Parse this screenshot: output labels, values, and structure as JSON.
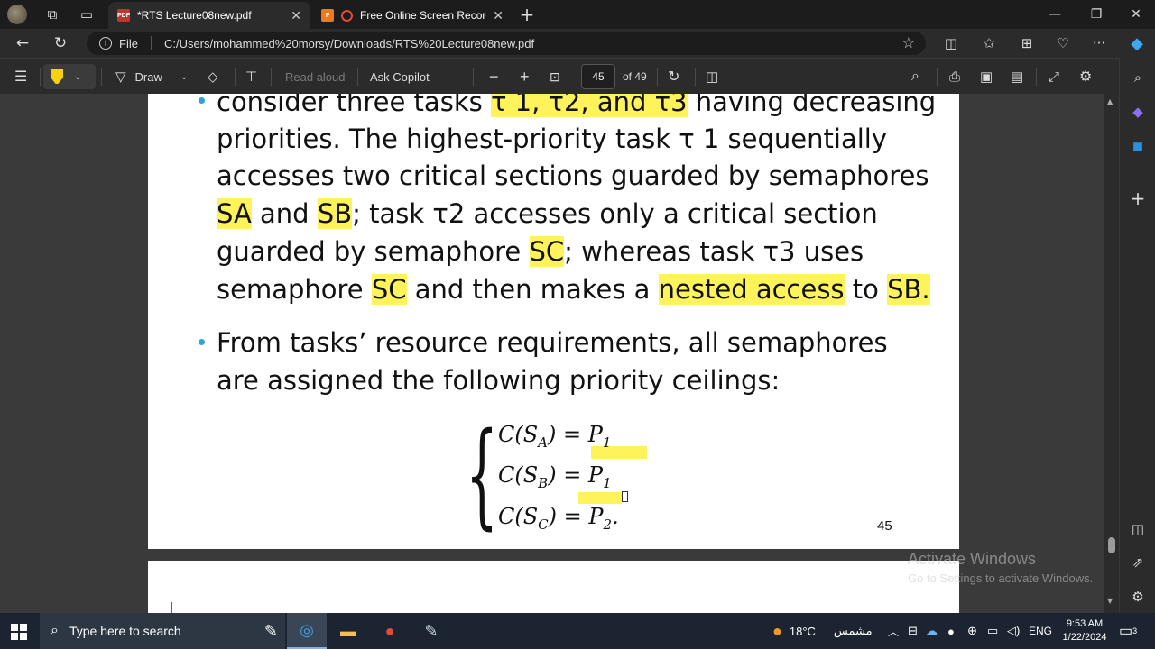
{
  "browser": {
    "tabs": [
      {
        "title": "*RTS Lecture08new.pdf",
        "active": true,
        "favicon": "pdf-icon"
      },
      {
        "title": "Free Online Screen Recorde",
        "active": false,
        "favicon": "recorder-icon"
      }
    ],
    "address": {
      "scheme": "File",
      "url": "C:/Users/mohammed%20morsy/Downloads/RTS%20Lecture08new.pdf"
    }
  },
  "pdf_toolbar": {
    "draw_label": "Draw",
    "read_aloud_label": "Read aloud",
    "ask_copilot_label": "Ask Copilot",
    "page_current": "45",
    "page_total": "of 49"
  },
  "document": {
    "bullet1_line1_a": " consider three tasks ",
    "bullet1_line1_hl": "τ 1, τ2, and τ3",
    "bullet1_line1_b": " having decreasing",
    "bullet1_line2": "priorities. The highest-priority task τ 1 sequentially",
    "bullet1_line3": "accesses two critical sections guarded by semaphores",
    "bullet1_line4_hl1": "SA",
    "bullet1_line4_a": " and ",
    "bullet1_line4_hl2": "SB",
    "bullet1_line4_b": "; task τ2 accesses only a critical section",
    "bullet1_line5_a": "guarded by semaphore ",
    "bullet1_line5_hl": "SC",
    "bullet1_line5_b": "; whereas task τ3 uses",
    "bullet1_line6_a": "semaphore ",
    "bullet1_line6_hl1": "SC",
    "bullet1_line6_b": " and then makes a ",
    "bullet1_line6_hl2": "nested access",
    "bullet1_line6_c": " to ",
    "bullet1_line6_hl3": "SB.",
    "bullet2_line1": "From tasks’ resource requirements, all semaphores",
    "bullet2_line2": "are assigned the following priority ceilings:",
    "formula": [
      {
        "lhs": "C(S",
        "sub": "A",
        "rhs": ") = P",
        "rsub": "1",
        "tail": ""
      },
      {
        "lhs": "C(S",
        "sub": "B",
        "rhs": ") = P",
        "rsub": "1",
        "tail": ""
      },
      {
        "lhs": "C(S",
        "sub": "C",
        "rhs": ") = P",
        "rsub": "2",
        "tail": "."
      }
    ],
    "page_number": "45"
  },
  "watermark": {
    "line1": "Activate Windows",
    "line2": "Go to Settings to activate Windows."
  },
  "taskbar": {
    "search_placeholder": "Type here to search",
    "weather_temp": "18°C",
    "weather_text": "مشمس",
    "language": "ENG",
    "time": "9:53 AM",
    "date": "1/22/2024",
    "notification_count": "3"
  },
  "colors": {
    "highlight": "#fef35a",
    "bullet": "#2aa6d6",
    "accent_pen": "#f5d20a"
  }
}
